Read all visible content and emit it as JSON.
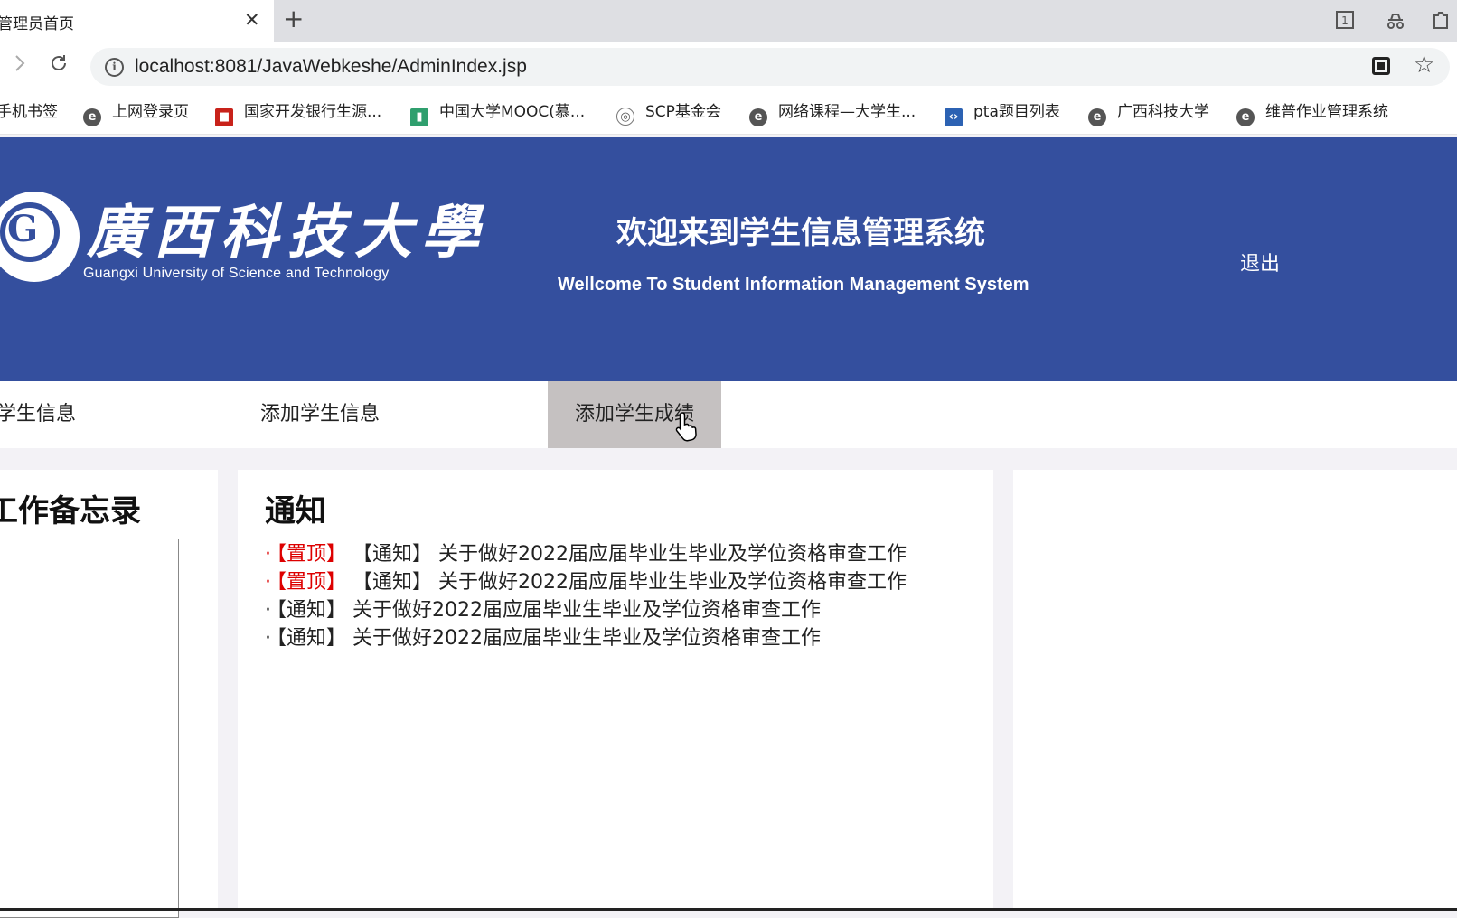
{
  "browser": {
    "tab_title": "管理员首页",
    "tab_close": "✕",
    "new_tab": "+",
    "url": "localhost:8081/JavaWebkeshe/AdminIndex.jsp",
    "bookmarks": [
      {
        "label": "手机书签",
        "icon": "bookmark-icon"
      },
      {
        "label": "上网登录页",
        "icon": "e-browser-icon"
      },
      {
        "label": "国家开发银行生源...",
        "icon": "cdb-icon"
      },
      {
        "label": "中国大学MOOC(慕...",
        "icon": "mooc-icon"
      },
      {
        "label": "SCP基金会",
        "icon": "scp-icon"
      },
      {
        "label": "网络课程—大学生...",
        "icon": "e-browser-icon"
      },
      {
        "label": "pta题目列表",
        "icon": "pta-icon"
      },
      {
        "label": "广西科技大学",
        "icon": "e-browser-icon"
      },
      {
        "label": "维普作业管理系统",
        "icon": "e-browser-icon"
      }
    ]
  },
  "header": {
    "logo_cn": "廣西科技大學",
    "logo_en": "Guangxi University of Science and Technology",
    "welcome_cn": "欢迎来到学生信息管理系统",
    "welcome_en": "Wellcome To Student Information Management System",
    "logout": "退出",
    "bg_color": "#344f9e"
  },
  "nav": {
    "items": [
      "学生信息",
      "添加学生信息",
      "添加学生成绩"
    ],
    "active_index": 2
  },
  "memo": {
    "title": "工作备忘录"
  },
  "notice": {
    "title": "通知",
    "items": [
      {
        "dot": "·",
        "pin": "【置顶】",
        "text": "【通知】 关于做好2022届应届毕业生毕业及学位资格审查工作"
      },
      {
        "dot": "·",
        "pin": "【置顶】",
        "text": "【通知】 关于做好2022届应届毕业生毕业及学位资格审查工作"
      },
      {
        "dot": "·",
        "pin": "",
        "text": "【通知】 关于做好2022届应届毕业生毕业及学位资格审查工作"
      },
      {
        "dot": "·",
        "pin": "",
        "text": "【通知】 关于做好2022届应届毕业生毕业及学位资格审查工作"
      }
    ]
  }
}
